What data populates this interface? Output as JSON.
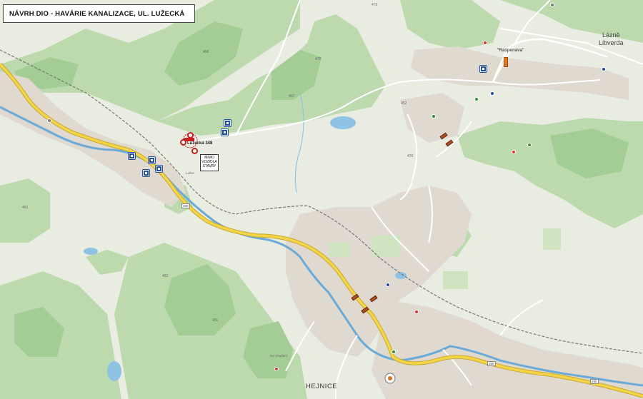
{
  "title": "NÁVRH DIO - HAVÁRIE KANALIZACE, UL. LUŽECKÁ",
  "places": {
    "lazne_libverda": "Lázně\nLibverda",
    "hejnice": "HEJNICE",
    "raspenava": "\"Raspenava\"",
    "address": "Lužecká 348",
    "na_chadanim": "Na Chadaní",
    "luzec": "Lužec"
  },
  "note_box": "MIMO\nVOZIDLA\nSTAVBY",
  "road_numbers": [
    "290",
    "290",
    "290"
  ],
  "elevations": [
    "473",
    "458",
    "476",
    "467",
    "452",
    "476",
    "461",
    "462",
    "451"
  ],
  "colors": {
    "forest": "#bddbb0",
    "forest_dark": "#a6cf98",
    "meadow": "#e6ecdc",
    "urban": "#ddd6cc",
    "water": "#8fc3e4",
    "river": "#6aaad8",
    "main_road": "#f3d54a",
    "main_road_edge": "#c9a82a",
    "sign_blue": "#1f4fa8",
    "closure_red": "#c81e1e",
    "work_orange": "#d9731f"
  }
}
